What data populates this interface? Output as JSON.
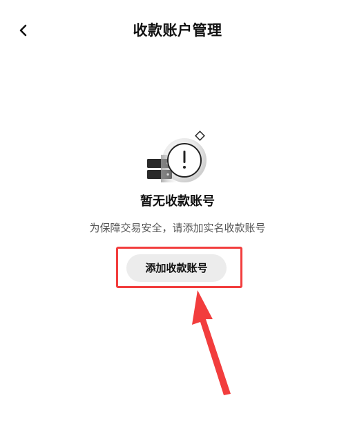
{
  "header": {
    "title": "收款账户管理",
    "back_icon": "chevron-left-icon"
  },
  "empty_state": {
    "illustration_icon": "empty-account-warning-icon",
    "title": "暂无收款账号",
    "hint": "为保障交易安全，请添加实名收款账号"
  },
  "actions": {
    "add_account_label": "添加收款账号"
  },
  "annotation": {
    "highlight_color": "#f23d3d",
    "arrow_color": "#f23d3d"
  },
  "colors": {
    "background": "#ffffff",
    "button_bg": "#ececec",
    "text_primary": "#111111",
    "text_secondary": "#555555"
  }
}
